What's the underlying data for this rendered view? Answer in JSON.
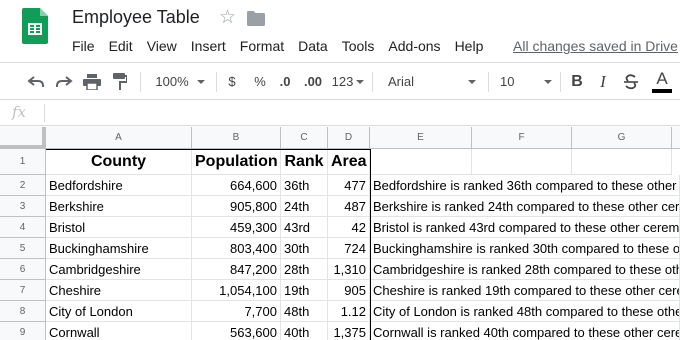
{
  "app": {
    "title": "Employee Table",
    "menu": [
      "File",
      "Edit",
      "View",
      "Insert",
      "Format",
      "Data",
      "Tools",
      "Add-ons",
      "Help"
    ],
    "saved_status": "All changes saved in Drive"
  },
  "toolbar": {
    "zoom": "100%",
    "currency": "$",
    "percent": "%",
    "decrease_decimals": ".0",
    "increase_decimals": ".00",
    "more_formats": "123",
    "font": "Arial",
    "font_size": "10",
    "bold": "B",
    "italic": "I",
    "text_color": "A"
  },
  "formula_bar": {
    "fx": "fx",
    "value": ""
  },
  "columns": [
    "A",
    "B",
    "C",
    "D",
    "E",
    "F",
    "G"
  ],
  "rows": [
    "1",
    "2",
    "3",
    "4",
    "5",
    "6",
    "7",
    "8",
    "9"
  ],
  "header": [
    "County",
    "Population",
    "Rank",
    "Area"
  ],
  "data": [
    [
      "Bedfordshire",
      "664,600",
      "36th",
      "477",
      "Bedfordshire is ranked 36th compared to these other"
    ],
    [
      "Berkshire",
      "905,800",
      "24th",
      "487",
      "Berkshire is ranked 24th compared to these other cer"
    ],
    [
      "Bristol",
      "459,300",
      "43rd",
      "42",
      "Bristol is ranked 43rd compared to these other cerem"
    ],
    [
      "Buckinghamshire",
      "803,400",
      "30th",
      "724",
      "Buckinghamshire is ranked 30th compared to these o"
    ],
    [
      "Cambridgeshire",
      "847,200",
      "28th",
      "1,310",
      "Cambridgeshire is ranked 28th compared to these oth"
    ],
    [
      "Cheshire",
      "1,054,100",
      "19th",
      "905",
      "Cheshire is ranked 19th compared to these other cere"
    ],
    [
      "City of London",
      "7,700",
      "48th",
      "1.12",
      "City of London is ranked 48th compared to these othe"
    ],
    [
      "Cornwall",
      "563,600",
      "40th",
      "1,375",
      "Cornwall is ranked 40th compared to these other cere"
    ]
  ],
  "colors": {
    "sheets_green": "#0F9D58",
    "header_bg": "#f8f9fa",
    "gridline": "#e2e3e3"
  }
}
